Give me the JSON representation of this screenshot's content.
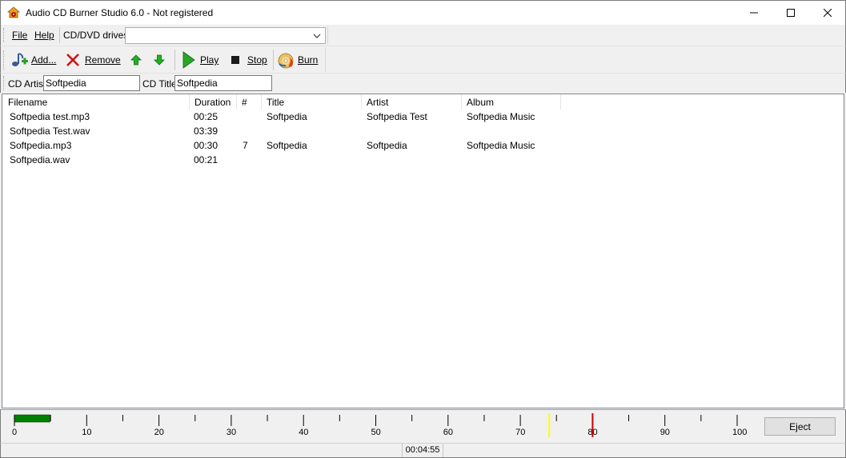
{
  "window": {
    "title": "Audio CD Burner Studio 6.0 - Not registered"
  },
  "menu": {
    "file": "File",
    "help": "Help",
    "drives_label": "CD/DVD drives",
    "drives_value": ""
  },
  "toolbar": {
    "add": "Add...",
    "remove": "Remove",
    "play": "Play",
    "stop": "Stop",
    "burn": "Burn"
  },
  "cdinfo": {
    "artist_label": "CD Artist",
    "artist_value": "Softpedia",
    "title_label": "CD Title",
    "title_value": "Softpedia"
  },
  "tracklist": {
    "columns": [
      "Filename",
      "Duration",
      "#",
      "Title",
      "Artist",
      "Album"
    ],
    "rows": [
      {
        "filename": "Softpedia test.mp3",
        "duration": "00:25",
        "num": "",
        "title": "Softpedia",
        "artist": "Softpedia Test",
        "album": "Softpedia Music"
      },
      {
        "filename": "Softpedia Test.wav",
        "duration": "03:39",
        "num": "",
        "title": "",
        "artist": "",
        "album": ""
      },
      {
        "filename": "Softpedia.mp3",
        "duration": "00:30",
        "num": "7",
        "title": "Softpedia",
        "artist": "Softpedia",
        "album": "Softpedia Music"
      },
      {
        "filename": "Softpedia.wav",
        "duration": "00:21",
        "num": "",
        "title": "",
        "artist": "",
        "album": ""
      }
    ]
  },
  "gauge": {
    "tick_labels": [
      "0",
      "10",
      "20",
      "30",
      "40",
      "50",
      "60",
      "70",
      "80",
      "90",
      "100"
    ],
    "max_minutes": 100,
    "used_minutes": 4.92,
    "yellow_marker_minutes": 74,
    "red_marker_minutes": 80,
    "used_color": "#008000",
    "yellow_color": "#ffff00",
    "red_color": "#cc0000",
    "eject_label": "Eject"
  },
  "status": {
    "total_time": "00:04:55"
  }
}
